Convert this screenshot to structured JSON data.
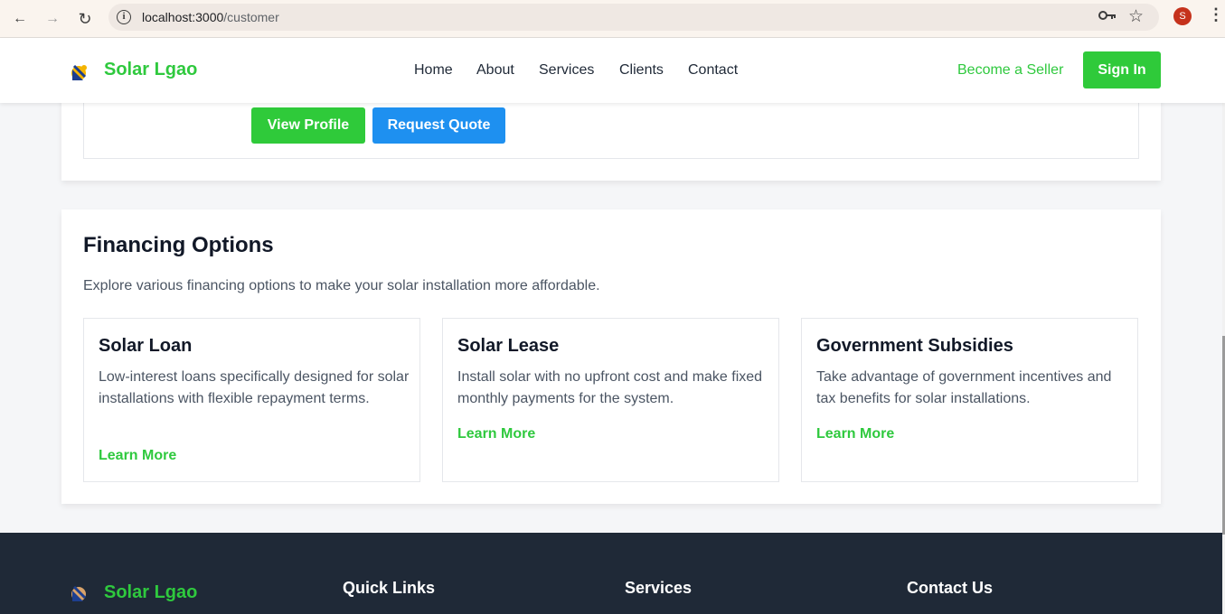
{
  "browser": {
    "url_host": "localhost:3000",
    "url_path": "/customer",
    "profile_initial": "S",
    "profile_color": "#c5321c"
  },
  "header": {
    "brand": "Solar Lgao",
    "nav": [
      "Home",
      "About",
      "Services",
      "Clients",
      "Contact"
    ],
    "become_seller": "Become a Seller",
    "sign_in": "Sign In"
  },
  "profile_card": {
    "view_profile": "View Profile",
    "request_quote": "Request Quote"
  },
  "financing": {
    "title": "Financing Options",
    "description": "Explore various financing options to make your solar installation more affordable.",
    "options": [
      {
        "title": "Solar Loan",
        "text": "Low-interest loans specifically designed for solar installations with flexible repayment terms.",
        "link": "Learn More"
      },
      {
        "title": "Solar Lease",
        "text": "Install solar with no upfront cost and make fixed monthly payments for the system.",
        "link": "Learn More"
      },
      {
        "title": "Government Subsidies",
        "text": "Take advantage of government incentives and tax benefits for solar installations.",
        "link": "Learn More"
      }
    ]
  },
  "footer": {
    "brand": "Solar Lgao",
    "headings": [
      "Quick Links",
      "Services",
      "Contact Us"
    ]
  },
  "colors": {
    "brand_green": "#2fc93e",
    "button_green": "#2fca3a",
    "button_blue": "#1e90f0",
    "footer_bg": "#1f2937"
  }
}
